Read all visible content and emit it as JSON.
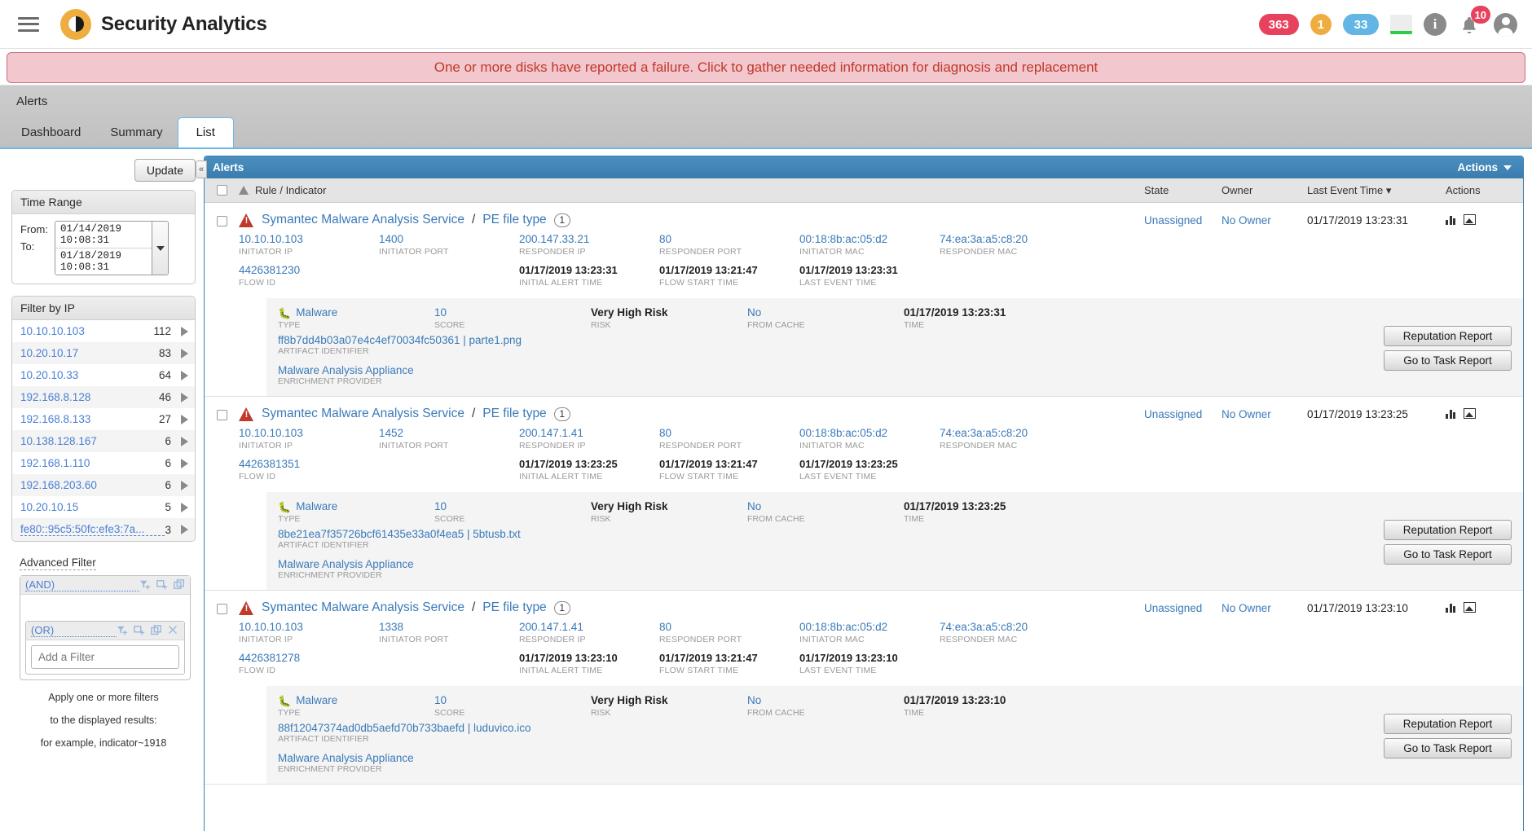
{
  "topbar": {
    "brand": "Security Analytics",
    "menu_icon": "hamburger-icon",
    "badges": [
      {
        "name": "critical-count",
        "value": "363",
        "color": "#e8415d"
      },
      {
        "name": "warning-count",
        "value": "1",
        "color": "#f0ad3f"
      },
      {
        "name": "info-count",
        "value": "33",
        "color": "#62b5e5"
      }
    ],
    "system_status_icon": "system-health-icon",
    "info_icon_label": "i",
    "notification_count": "10"
  },
  "banner": {
    "message": "One or more disks have reported a failure. Click to gather needed information for diagnosis and replacement"
  },
  "breadcrumb": "Alerts",
  "tabs": [
    {
      "label": "Dashboard",
      "active": false
    },
    {
      "label": "Summary",
      "active": false
    },
    {
      "label": "List",
      "active": true
    }
  ],
  "sidebar": {
    "update_button": "Update",
    "time_range": {
      "title": "Time Range",
      "from_label": "From:",
      "to_label": "To:",
      "from_value": "01/14/2019  10:08:31",
      "to_value": "01/18/2019  10:08:31"
    },
    "filter_by_ip": {
      "title": "Filter by IP",
      "rows": [
        {
          "ip": "10.10.10.103",
          "count": "112"
        },
        {
          "ip": "10.20.10.17",
          "count": "83"
        },
        {
          "ip": "10.20.10.33",
          "count": "64"
        },
        {
          "ip": "192.168.8.128",
          "count": "46"
        },
        {
          "ip": "192.168.8.133",
          "count": "27"
        },
        {
          "ip": "10.138.128.167",
          "count": "6"
        },
        {
          "ip": "192.168.1.110",
          "count": "6"
        },
        {
          "ip": "192.168.203.60",
          "count": "6"
        },
        {
          "ip": "10.20.10.15",
          "count": "5"
        },
        {
          "ip": "fe80::95c5:50fc:efe3:7a...",
          "count": "3"
        }
      ]
    },
    "advanced_filter": {
      "title": "Advanced Filter",
      "and_group": "(AND)",
      "or_group": "(OR)",
      "add_filter_placeholder": "Add a Filter",
      "hint_line1": "Apply one or more filters",
      "hint_line2": "to the displayed results:",
      "hint_line3": "for example, indicator~1918"
    }
  },
  "alerts_panel": {
    "title": "Alerts",
    "actions_label": "Actions",
    "collapse_label": "«",
    "columns": {
      "rule": "Rule / Indicator",
      "state": "State",
      "owner": "Owner",
      "last_event_time": "Last Event Time ▾",
      "actions": "Actions"
    },
    "field_labels": {
      "initiator_ip": "INITIATOR IP",
      "initiator_port": "INITIATOR PORT",
      "responder_ip": "RESPONDER IP",
      "responder_port": "RESPONDER PORT",
      "initiator_mac": "INITIATOR MAC",
      "responder_mac": "RESPONDER MAC",
      "flow_id": "FLOW ID",
      "initial_alert_time": "INITIAL ALERT TIME",
      "flow_start_time": "FLOW START TIME",
      "last_event_time": "LAST EVENT TIME",
      "type": "TYPE",
      "score": "SCORE",
      "risk": "RISK",
      "from_cache": "FROM CACHE",
      "time": "TIME",
      "artifact_identifier": "ARTIFACT IDENTIFIER",
      "enrichment_provider": "ENRICHMENT PROVIDER"
    },
    "detail_buttons": {
      "reputation": "Reputation Report",
      "task": "Go to Task Report"
    },
    "rows": [
      {
        "rule_service": "Symantec Malware Analysis Service",
        "rule_indicator": "PE file type",
        "badge": "1",
        "initiator_ip": "10.10.10.103",
        "initiator_port": "1400",
        "responder_ip": "200.147.33.21",
        "responder_port": "80",
        "initiator_mac": "00:18:8b:ac:05:d2",
        "responder_mac": "74:ea:3a:a5:c8:20",
        "flow_id": "4426381230",
        "initial_alert_time": "01/17/2019 13:23:31",
        "flow_start_time": "01/17/2019 13:21:47",
        "last_event_time_field": "01/17/2019 13:23:31",
        "state": "Unassigned",
        "owner": "No Owner",
        "last_event_time": "01/17/2019 13:23:31",
        "detail": {
          "type": "Malware",
          "score": "10",
          "risk": "Very High Risk",
          "from_cache": "No",
          "time": "01/17/2019 13:23:31",
          "artifact": "ff8b7dd4b03a07e4c4ef70034fc50361 | parte1.png",
          "provider": "Malware Analysis Appliance"
        }
      },
      {
        "rule_service": "Symantec Malware Analysis Service",
        "rule_indicator": "PE file type",
        "badge": "1",
        "initiator_ip": "10.10.10.103",
        "initiator_port": "1452",
        "responder_ip": "200.147.1.41",
        "responder_port": "80",
        "initiator_mac": "00:18:8b:ac:05:d2",
        "responder_mac": "74:ea:3a:a5:c8:20",
        "flow_id": "4426381351",
        "initial_alert_time": "01/17/2019 13:23:25",
        "flow_start_time": "01/17/2019 13:21:47",
        "last_event_time_field": "01/17/2019 13:23:25",
        "state": "Unassigned",
        "owner": "No Owner",
        "last_event_time": "01/17/2019 13:23:25",
        "detail": {
          "type": "Malware",
          "score": "10",
          "risk": "Very High Risk",
          "from_cache": "No",
          "time": "01/17/2019 13:23:25",
          "artifact": "8be21ea7f35726bcf61435e33a0f4ea5 | 5btusb.txt",
          "provider": "Malware Analysis Appliance"
        }
      },
      {
        "rule_service": "Symantec Malware Analysis Service",
        "rule_indicator": "PE file type",
        "badge": "1",
        "initiator_ip": "10.10.10.103",
        "initiator_port": "1338",
        "responder_ip": "200.147.1.41",
        "responder_port": "80",
        "initiator_mac": "00:18:8b:ac:05:d2",
        "responder_mac": "74:ea:3a:a5:c8:20",
        "flow_id": "4426381278",
        "initial_alert_time": "01/17/2019 13:23:10",
        "flow_start_time": "01/17/2019 13:21:47",
        "last_event_time_field": "01/17/2019 13:23:10",
        "state": "Unassigned",
        "owner": "No Owner",
        "last_event_time": "01/17/2019 13:23:10",
        "detail": {
          "type": "Malware",
          "score": "10",
          "risk": "Very High Risk",
          "from_cache": "No",
          "time": "01/17/2019 13:23:10",
          "artifact": "88f12047374ad0db5aefd70b733baefd | luduvico.ico",
          "provider": "Malware Analysis Appliance"
        }
      }
    ]
  }
}
